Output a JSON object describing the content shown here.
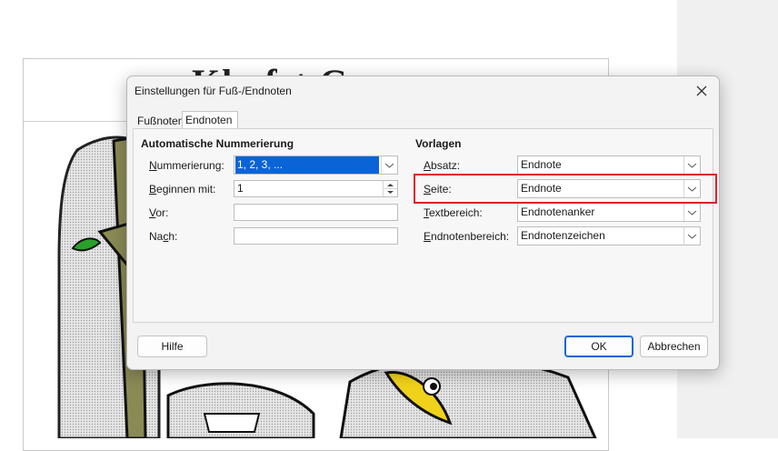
{
  "document": {
    "heading": "Kla  fst   G"
  },
  "dialog": {
    "title": "Einstellungen für Fuß-/Endnoten",
    "tabs": [
      {
        "label": "Fußnoten",
        "active": false
      },
      {
        "label": "Endnoten",
        "active": true
      }
    ],
    "auto_numbering": {
      "heading": "Automatische Nummerierung",
      "numbering": {
        "label": "Nummerierung:",
        "accel": "N",
        "value": "1, 2, 3, ..."
      },
      "start_at": {
        "label": "Beginnen mit:",
        "accel": "B",
        "value": "1"
      },
      "before": {
        "label": "Vor:",
        "accel": "V",
        "value": ""
      },
      "after": {
        "label": "Nach:",
        "accel": "c",
        "value": ""
      }
    },
    "styles": {
      "heading": "Vorlagen",
      "paragraph": {
        "label": "Absatz:",
        "accel": "A",
        "value": "Endnote"
      },
      "page": {
        "label": "Seite:",
        "accel": "S",
        "value": "Endnote"
      },
      "text_area": {
        "label": "Textbereich:",
        "accel": "T",
        "value": "Endnotenanker"
      },
      "endnote_area": {
        "label": "Endnotenbereich:",
        "accel": "E",
        "value": "Endnotenzeichen"
      }
    },
    "buttons": {
      "help": "Hilfe",
      "ok": "OK",
      "cancel": "Abbrechen"
    }
  },
  "colors": {
    "accent": "#0a64d6",
    "highlight": "#e0202a"
  }
}
